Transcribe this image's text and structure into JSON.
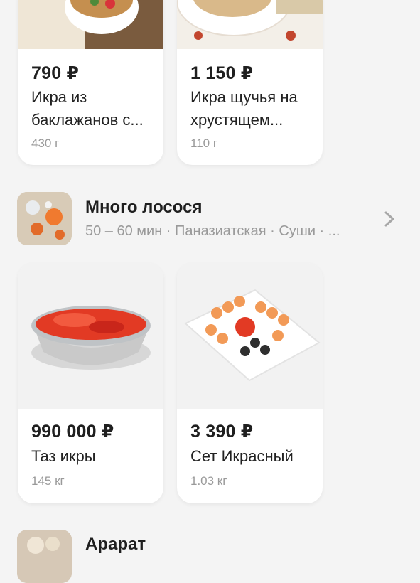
{
  "products_top": [
    {
      "price": "790 ₽",
      "name": "Икра из баклажанов с...",
      "weight": "430 г"
    },
    {
      "price": "1 150 ₽",
      "name": "Икра щучья на хрустящем...",
      "weight": "110 г"
    }
  ],
  "restaurant": {
    "name": "Много лосося",
    "meta": "50 – 60 мин · Паназиатская · Суши · ..."
  },
  "products_bottom": [
    {
      "price": "990 000 ₽",
      "name": "Таз икры",
      "weight": "145 кг"
    },
    {
      "price": "3 390 ₽",
      "name": "Сет Икрасный",
      "weight": "1.03 кг"
    }
  ],
  "next_restaurant": {
    "name": "Арарат"
  },
  "icons": {
    "chevron": "chevron-right-icon"
  },
  "colors": {
    "accent_red": "#e0311f",
    "muted_text": "#9a9a9a"
  }
}
